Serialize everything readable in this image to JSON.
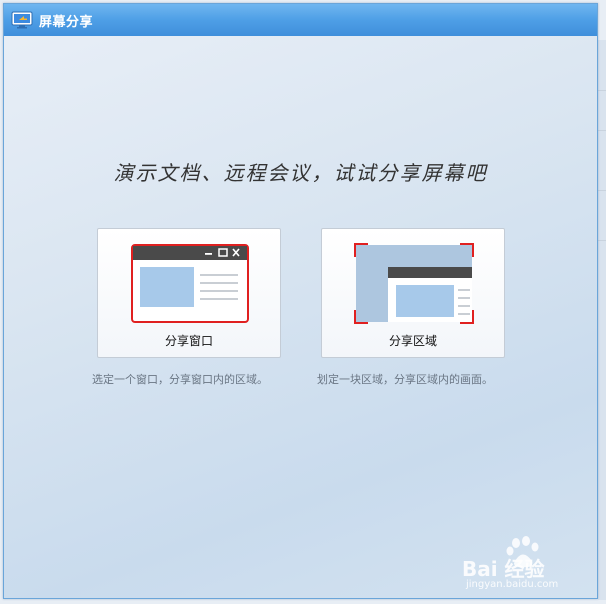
{
  "window": {
    "title": "屏幕分享",
    "headline": "演示文档、远程会议，试试分享屏幕吧"
  },
  "options": [
    {
      "label": "分享窗口",
      "description": "选定一个窗口，分享窗口内的区域。"
    },
    {
      "label": "分享区域",
      "description": "划定一块区域，分享区域内的画面。"
    }
  ],
  "watermark": {
    "brand": "Bai 经验",
    "url": "jingyan.baidu.com"
  },
  "colors": {
    "titlebar": "#4e9fe6",
    "selection": "#e02020",
    "accent": "#a7c9ea"
  }
}
